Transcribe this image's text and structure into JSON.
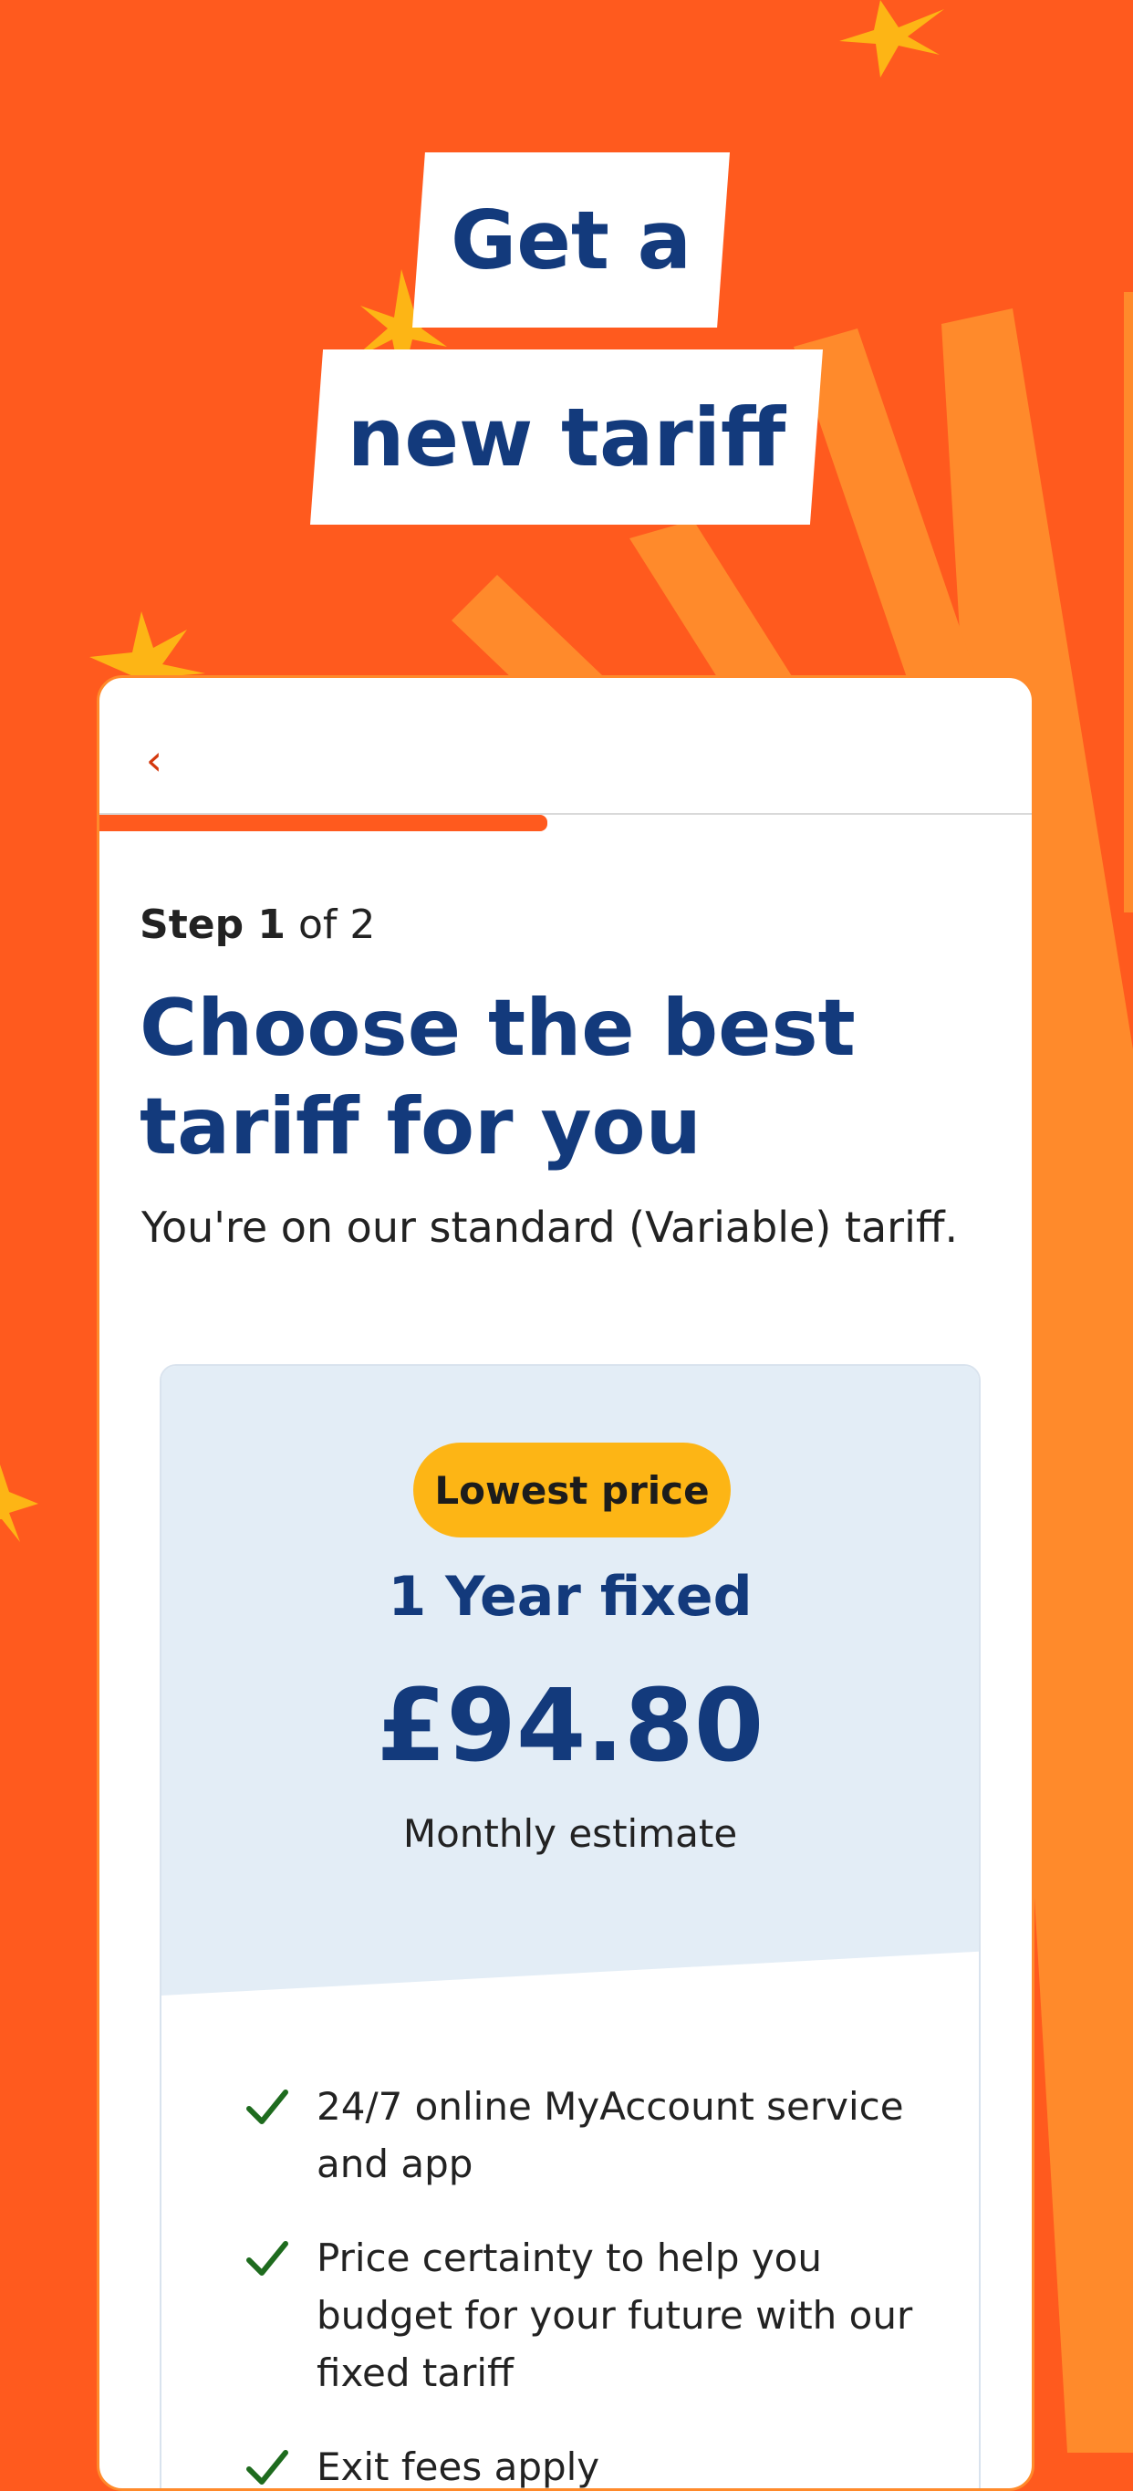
{
  "hero": {
    "title_line1": "Get a",
    "title_line2": "new tariff"
  },
  "header": {
    "back_icon": "chevron-left-icon",
    "back_glyph": "‹"
  },
  "progress": {
    "fraction": 0.5
  },
  "step": {
    "label": "Step 1",
    "of_text": "of 2"
  },
  "page": {
    "heading": "Choose the best tariff for you",
    "subtext": "You're on our standard (Variable) tariff."
  },
  "tariff": {
    "badge": "Lowest price",
    "name": "1 Year fixed",
    "price": "£94.80",
    "price_note": "Monthly estimate",
    "features": [
      "24/7 online MyAccount service and app",
      "Price certainty to help you budget for your future with our fixed tariff",
      "Exit fees apply"
    ]
  },
  "colors": {
    "background": "#ff5a1e",
    "accent_orange": "#ff8a2b",
    "brand_navy": "#133a7c",
    "badge_yellow": "#fdb515",
    "panel_blue": "#e3edf6",
    "check_green": "#1e6b1e"
  }
}
